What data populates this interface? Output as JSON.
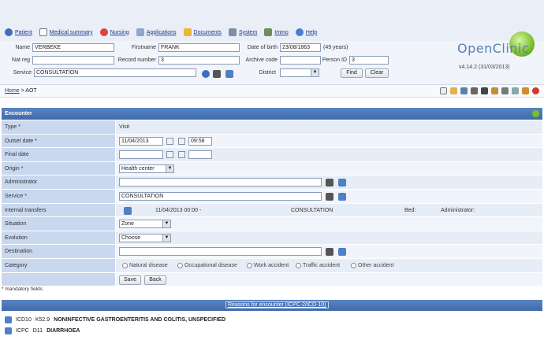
{
  "menu": [
    {
      "label": "Patient",
      "icon": "patient-icon"
    },
    {
      "label": "Medical summary",
      "icon": "document-icon"
    },
    {
      "label": "Nursing",
      "icon": "nursing-icon"
    },
    {
      "label": "Applications",
      "icon": "applications-icon"
    },
    {
      "label": "Documents",
      "icon": "documents-icon"
    },
    {
      "label": "System",
      "icon": "system-icon"
    },
    {
      "label": "Immo",
      "icon": "immo-icon"
    },
    {
      "label": "Help",
      "icon": "help-icon"
    }
  ],
  "patient": {
    "name_label": "Name",
    "name_value": "VERBEKE",
    "firstname_label": "Firstname",
    "firstname_value": "FRANK",
    "dob_label": "Date of birth",
    "dob_value": "23/08/1863",
    "age": "(49 years)",
    "natreg_label": "Nat reg",
    "natreg_value": "",
    "record_label": "Record number",
    "record_value": "3",
    "archive_label": "Archive code",
    "archive_value": "",
    "personid_label": "Person ID",
    "personid_value": "3",
    "service_label": "Service",
    "service_value": "CONSULTATION",
    "district_label": "District",
    "district_value": "",
    "find_label": "Find",
    "clear_label": "Clear"
  },
  "logo_text": "OpenClinic",
  "version": "v4.14.2 (31/03/2013)",
  "breadcrumb": {
    "home": "Home",
    "separator": ">",
    "current": "AOT"
  },
  "encounter": {
    "title": "Encounter",
    "type_label": "Type *",
    "type_value": "Visit",
    "outset_label": "Outset date *",
    "outset_date": "11/04/2013",
    "outset_time": "09:58",
    "final_label": "Final date",
    "origin_label": "Origin *",
    "origin_value": "Health center",
    "administrator_label": "Administrator",
    "service_label": "Service *",
    "service_value": "CONSULTATION",
    "transfers_label": "Internal transfers",
    "transfer_date": "11/04/2013 00:00 -",
    "transfer_service": "CONSULTATION",
    "bed_label": "Bed:",
    "admin_label": "Administrator:",
    "situation_label": "Situation",
    "situation_value": "Zone",
    "evolution_label": "Evolution",
    "evolution_value": "Choose",
    "destination_label": "Destination",
    "category_label": "Category",
    "categories": [
      "Natural disease",
      "Occupational disease",
      "Work accident",
      "Traffic accident",
      "Other accident"
    ],
    "save_label": "Save",
    "back_label": "Back"
  },
  "mandatory_note": "* mandatory fields",
  "reasons_link": "Reasons for encounter (ICPC-2/ICD-10)",
  "diagnoses": [
    {
      "code_system": "ICD10",
      "code": "K52.9",
      "text": "NONINFECTIVE GASTROENTERITIS AND COLITIS, UNSPECIFIED"
    },
    {
      "code_system": "ICPC",
      "code": "D11",
      "text": "DIARRHOEA"
    }
  ]
}
